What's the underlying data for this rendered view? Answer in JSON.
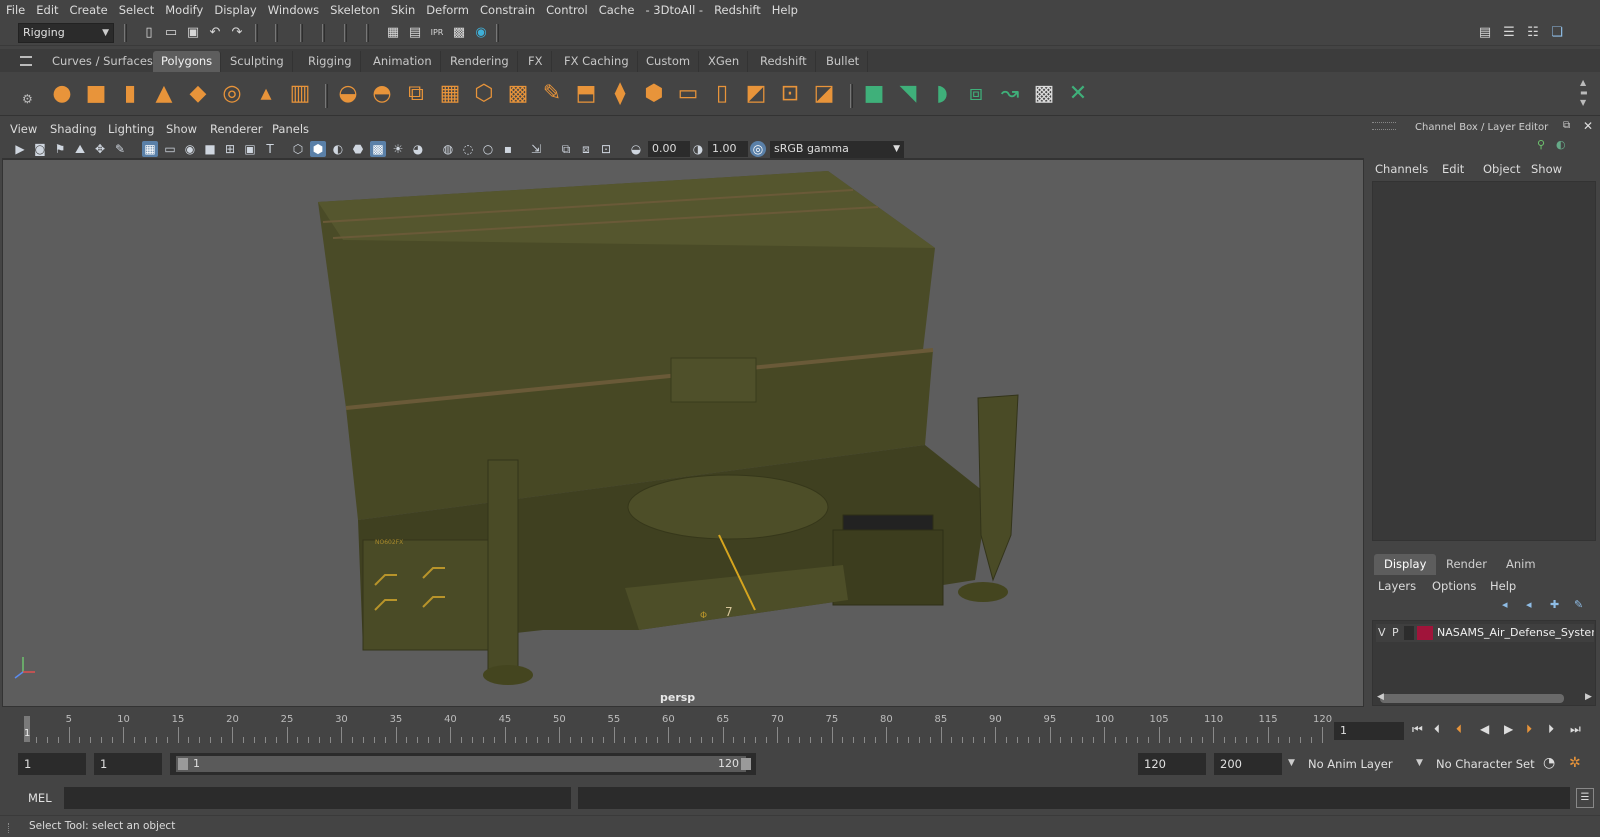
{
  "menu": [
    "File",
    "Edit",
    "Create",
    "Select",
    "Modify",
    "Display",
    "Windows",
    "Skeleton",
    "Skin",
    "Deform",
    "Constrain",
    "Control",
    "Cache",
    "- 3DtoAll -",
    "Redshift",
    "Help"
  ],
  "status": {
    "mode": "Rigging"
  },
  "shelf_tabs": [
    "Curves / Surfaces",
    "Polygons",
    "Sculpting",
    "Rigging",
    "Animation",
    "Rendering",
    "FX",
    "FX Caching",
    "Custom",
    "XGen",
    "Redshift",
    "Bullet"
  ],
  "shelf_active": "Polygons",
  "viewport": {
    "menu": [
      "View",
      "Shading",
      "Lighting",
      "Show",
      "Renderer",
      "Panels"
    ],
    "exposure": "0.00",
    "gamma": "1.00",
    "color_space": "sRGB gamma",
    "camera": "persp",
    "model_decal": "7",
    "model_letter": "Φ",
    "model_stencil": "NO602FX"
  },
  "channel_box": {
    "title": "Channel Box / Layer Editor",
    "menu": [
      "Channels",
      "Edit",
      "Object",
      "Show"
    ]
  },
  "layer_editor": {
    "tabs": [
      "Display",
      "Render",
      "Anim"
    ],
    "menu": [
      "Layers",
      "Options",
      "Help"
    ],
    "layers": [
      {
        "v": "V",
        "p": "P",
        "name": "NASAMS_Air_Defense_System_i",
        "color": "#a0143a"
      }
    ]
  },
  "timeline": {
    "ticks": [
      "5",
      "10",
      "15",
      "20",
      "25",
      "30",
      "35",
      "40",
      "45",
      "50",
      "55",
      "60",
      "65",
      "70",
      "75",
      "80",
      "85",
      "90",
      "95",
      "100",
      "105",
      "110",
      "115",
      "120"
    ],
    "current_marker": "1",
    "current_frame": "1"
  },
  "range": {
    "start": "1",
    "playback_start": "1",
    "slider_start": "1",
    "slider_end": "120",
    "playback_end": "120",
    "end": "200",
    "anim_layer": "No Anim Layer",
    "character_set": "No Character Set"
  },
  "command": {
    "lang": "MEL"
  },
  "help_line": "Select Tool: select an object"
}
